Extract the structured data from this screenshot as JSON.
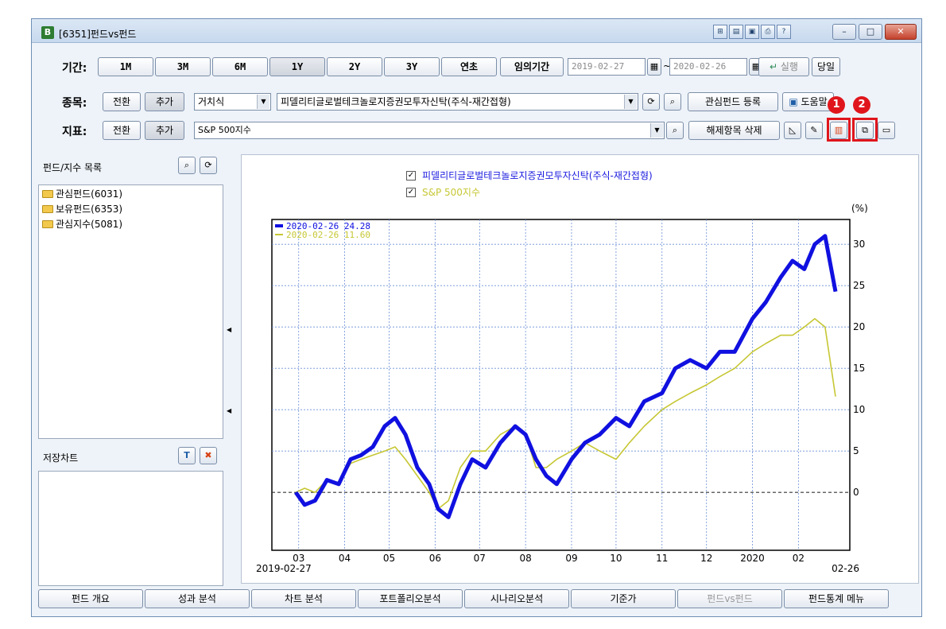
{
  "window": {
    "app_badge": "B",
    "title": "[6351]펀드vs펀드",
    "controls": {
      "minimize": "–",
      "maximize": "□",
      "close": "✕"
    }
  },
  "period": {
    "label": "기간:",
    "buttons": [
      "1M",
      "3M",
      "6M",
      "1Y",
      "2Y",
      "3Y",
      "연초",
      "임의기간"
    ],
    "selected": "1Y",
    "start_date": "2019-02-27",
    "end_date": "2020-02-26",
    "separator": "~",
    "run_label": "실행",
    "today_label": "당일"
  },
  "item": {
    "label": "종목:",
    "switch_label": "전환",
    "add_label": "추가",
    "type_value": "거치식",
    "fund_value": "피델리티글로벌테크놀로지증권모투자신탁(주식-재간접형)",
    "register_label": "관심펀드 등록",
    "help_label": "도움말"
  },
  "index": {
    "label": "지표:",
    "switch_label": "전환",
    "add_label": "추가",
    "index_value": "S&P 500지수",
    "delete_label": "해제항목 삭제"
  },
  "annotations": {
    "badge1": "1",
    "badge2": "2"
  },
  "left": {
    "list_title": "펀드/지수 목록",
    "tree": [
      "관심펀드(6031)",
      "보유펀드(6353)",
      "관심지수(5081)"
    ],
    "saved_title": "저장차트"
  },
  "legend": {
    "fund": "피델리티글로벌테크놀로지증권모투자신탁(주식-재간접형)",
    "index": "S&P 500지수",
    "fund_color": "#1010e0",
    "index_color": "#c6c734"
  },
  "bottom_tabs": [
    "펀드 개요",
    "성과 분석",
    "차트 분석",
    "포트폴리오분석",
    "시나리오분석",
    "기준가",
    "펀드vs펀드",
    "펀드통계 메뉴"
  ],
  "chart_data": {
    "type": "line",
    "ylabel": "(%)",
    "ylim": [
      -7,
      33
    ],
    "yticks": [
      0,
      5,
      10,
      15,
      20,
      25,
      30
    ],
    "x_tick_labels": [
      "03",
      "04",
      "05",
      "06",
      "07",
      "08",
      "09",
      "10",
      "11",
      "12",
      "2020",
      "02"
    ],
    "x_start_label": "2019-02-27",
    "x_end_label": "02-26",
    "tooltip": [
      "2020-02-26 24.28",
      "2020-02-26 11.60"
    ],
    "series": [
      {
        "name": "피델리티글로벌테크놀로지증권모투자신탁(주식-재간접형)",
        "color": "#1010e0",
        "x": [
          "2019-02-27",
          "2019-03-05",
          "2019-03-12",
          "2019-03-20",
          "2019-03-28",
          "2019-04-05",
          "2019-04-12",
          "2019-04-20",
          "2019-04-28",
          "2019-05-05",
          "2019-05-12",
          "2019-05-20",
          "2019-05-28",
          "2019-06-03",
          "2019-06-10",
          "2019-06-18",
          "2019-06-26",
          "2019-07-05",
          "2019-07-15",
          "2019-07-25",
          "2019-08-01",
          "2019-08-08",
          "2019-08-15",
          "2019-08-22",
          "2019-09-01",
          "2019-09-10",
          "2019-09-20",
          "2019-10-01",
          "2019-10-10",
          "2019-10-20",
          "2019-11-01",
          "2019-11-10",
          "2019-11-20",
          "2019-12-01",
          "2019-12-10",
          "2019-12-20",
          "2020-01-01",
          "2020-01-10",
          "2020-01-20",
          "2020-01-28",
          "2020-02-05",
          "2020-02-12",
          "2020-02-19",
          "2020-02-26"
        ],
        "values": [
          0,
          -1.5,
          -1,
          1.5,
          1,
          4,
          4.5,
          5.5,
          8,
          9,
          7,
          3,
          1,
          -2,
          -3,
          1,
          4,
          3,
          6,
          8,
          7,
          4,
          2,
          1,
          4,
          6,
          7,
          9,
          8,
          11,
          12,
          15,
          16,
          15,
          17,
          17,
          21,
          23,
          26,
          28,
          27,
          30,
          31,
          24.28
        ]
      },
      {
        "name": "S&P 500지수",
        "color": "#c6c734",
        "x": [
          "2019-02-27",
          "2019-03-05",
          "2019-03-12",
          "2019-03-20",
          "2019-03-28",
          "2019-04-05",
          "2019-04-12",
          "2019-04-20",
          "2019-04-28",
          "2019-05-05",
          "2019-05-12",
          "2019-05-20",
          "2019-05-28",
          "2019-06-03",
          "2019-06-10",
          "2019-06-18",
          "2019-06-26",
          "2019-07-05",
          "2019-07-15",
          "2019-07-25",
          "2019-08-01",
          "2019-08-08",
          "2019-08-15",
          "2019-08-22",
          "2019-09-01",
          "2019-09-10",
          "2019-09-20",
          "2019-10-01",
          "2019-10-10",
          "2019-10-20",
          "2019-11-01",
          "2019-11-10",
          "2019-11-20",
          "2019-12-01",
          "2019-12-10",
          "2019-12-20",
          "2020-01-01",
          "2020-01-10",
          "2020-01-20",
          "2020-01-28",
          "2020-02-05",
          "2020-02-12",
          "2020-02-19",
          "2020-02-26"
        ],
        "values": [
          0,
          0.5,
          0,
          1.5,
          1,
          3.5,
          4,
          4.5,
          5,
          5.5,
          4,
          2,
          0,
          -2,
          -1,
          3,
          5,
          5,
          7,
          8,
          7,
          3,
          3,
          4,
          5,
          6,
          5,
          4,
          6,
          8,
          10,
          11,
          12,
          13,
          14,
          15,
          17,
          18,
          19,
          19,
          20,
          21,
          20,
          11.6
        ]
      }
    ]
  }
}
